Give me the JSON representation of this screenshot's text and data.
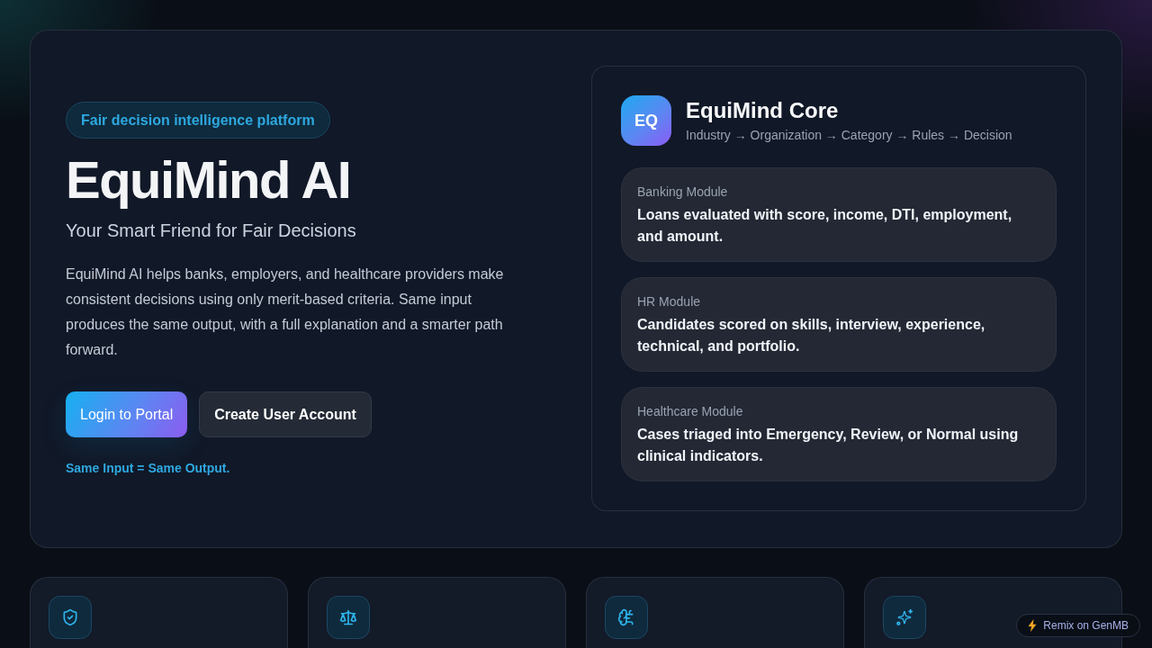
{
  "hero": {
    "tag": "Fair decision intelligence platform",
    "title": "EquiMind AI",
    "subtitle": "Your Smart Friend for Fair Decisions",
    "description": "EquiMind AI helps banks, employers, and healthcare providers make consistent decisions using only merit-based criteria. Same input produces the same output, with a full explanation and a smarter path forward.",
    "buttons": [
      {
        "label": "Login to Portal",
        "kind": "primary"
      },
      {
        "label": "Create User Account",
        "kind": "secondary"
      }
    ],
    "note": "Same Input = Same Output."
  },
  "core_panel": {
    "logo": "EQ",
    "title": "EquiMind Core",
    "pipeline": "Industry → Organization → Category → Rules → Decision",
    "modules": [
      {
        "label": "Banking Module",
        "description": "Loans evaluated with score, income, DTI, employment, and amount."
      },
      {
        "label": "HR Module",
        "description": "Candidates scored on skills, interview, experience, technical, and portfolio."
      },
      {
        "label": "Healthcare Module",
        "description": "Cases triaged into Emergency, Review, or Normal using clinical indicators."
      }
    ]
  },
  "remix_badge": {
    "label": "Remix on GenMB"
  }
}
